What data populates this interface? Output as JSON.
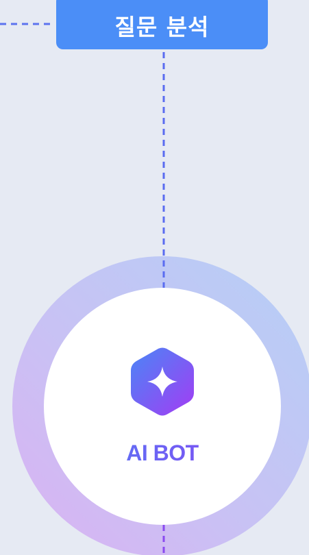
{
  "step_badge": {
    "label": "질문 분석"
  },
  "bot": {
    "label": "AI BOT",
    "icon": "sparkle-hexagon-icon"
  },
  "colors": {
    "background": "#e6eaf3",
    "badge": "#4b8ef7",
    "connector": "#5a6cf0",
    "ring_top": "#b6cdf5",
    "ring_bottom": "#d6b4f3",
    "accent_start": "#4f7ef6",
    "accent_end": "#8b45f2"
  }
}
